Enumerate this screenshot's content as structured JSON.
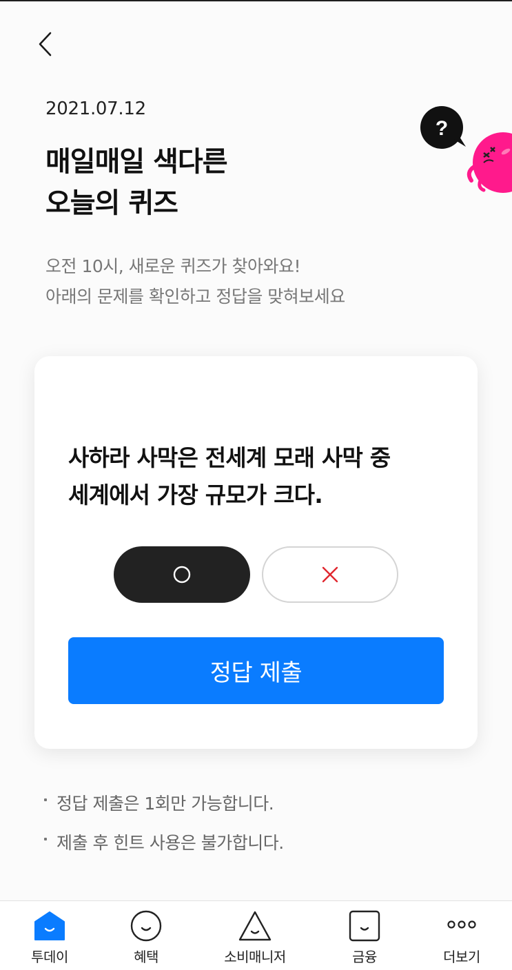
{
  "header": {
    "back_icon": "chevron-left-icon",
    "date": "2021.07.12",
    "title_lines": [
      "매일매일 색다른",
      "오늘의 퀴즈"
    ],
    "subtitle_lines": [
      "오전 10시, 새로운 퀴즈가 찾아와요!",
      "아래의 문제를 확인하고 정답을 맞혀보세요"
    ]
  },
  "mascot": {
    "bubble_text": "?",
    "icon": "quiz-mascot-illustration"
  },
  "quiz": {
    "question_lines": [
      "사하라 사막은 전세계 모래 사막 중",
      "세계에서 가장 규모가 크다."
    ],
    "option_o": "○",
    "option_x": "×",
    "selected": "O",
    "submit_label": "정답 제출"
  },
  "notes": [
    "정답 제출은 1회만 가능합니다.",
    "제출 후 힌트 사용은 불가합니다."
  ],
  "bottom_nav": {
    "items": [
      {
        "label": "투데이",
        "icon": "home-icon",
        "active": true
      },
      {
        "label": "혜택",
        "icon": "smile-circle-icon",
        "active": false
      },
      {
        "label": "소비매니저",
        "icon": "triangle-face-icon",
        "active": false
      },
      {
        "label": "금융",
        "icon": "square-face-icon",
        "active": false
      },
      {
        "label": "더보기",
        "icon": "more-dots-icon",
        "active": false
      }
    ]
  },
  "colors": {
    "accent": "#0a7cff",
    "mascot_pink": "#ff1a8c",
    "option_x_red": "#e0262e",
    "option_o_bg": "#222222"
  }
}
